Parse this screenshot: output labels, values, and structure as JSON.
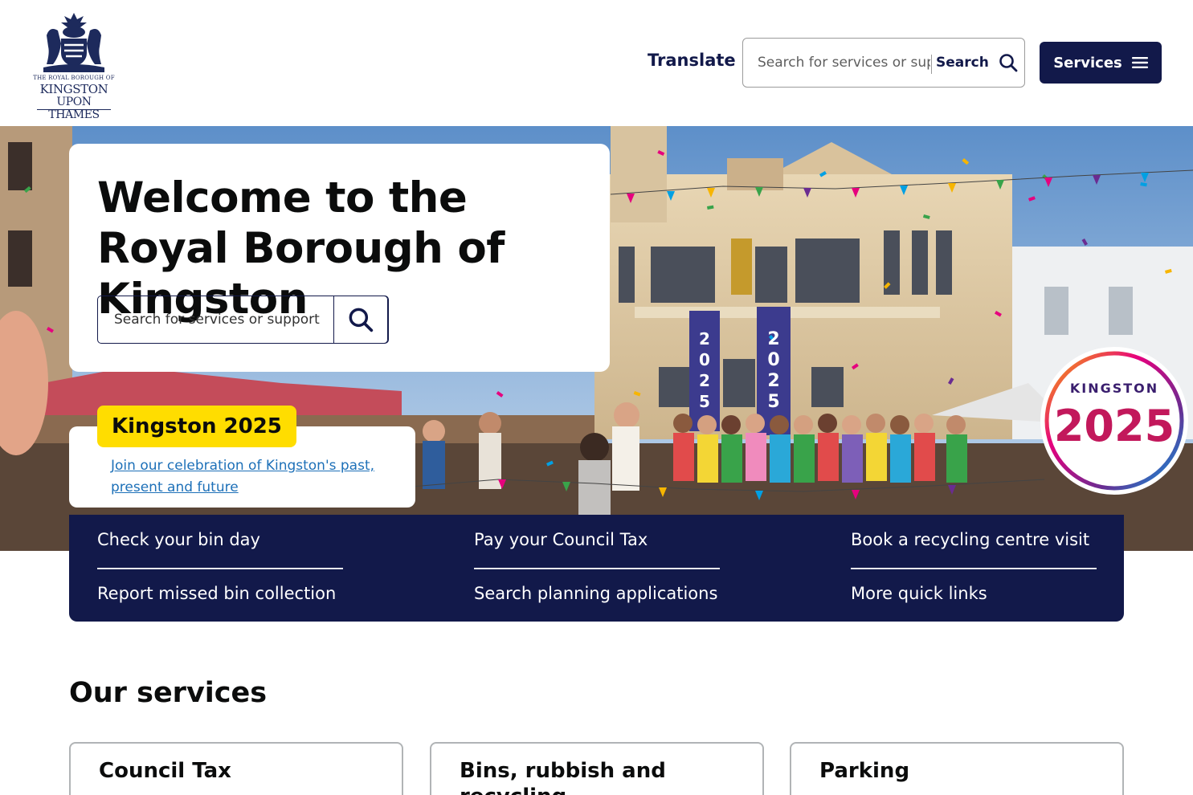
{
  "header": {
    "logo": {
      "small_text": "THE ROYAL BOROUGH OF",
      "line1": "KINGSTON",
      "line2": "UPON THAMES"
    },
    "translate_label": "Translate",
    "search": {
      "placeholder": "Search for services or support",
      "button_label": "Search",
      "icon": "search-icon"
    },
    "services_button": {
      "label": "Services",
      "icon": "menu-icon"
    }
  },
  "hero": {
    "title": "Welcome to the Royal Borough of Kingston",
    "search": {
      "placeholder": "Search for services or support",
      "icon": "search-icon"
    },
    "badge_logo": {
      "line1": "KINGSTON",
      "line2": "2025"
    },
    "banners": [
      "2025",
      "2025"
    ]
  },
  "promo": {
    "badge": "Kingston 2025",
    "link": "Join our celebration of Kingston's past, present and future"
  },
  "quick_links": [
    {
      "label": "Check your bin day"
    },
    {
      "label": "Pay your Council Tax"
    },
    {
      "label": "Book a recycling centre visit"
    },
    {
      "label": "Report missed bin collection"
    },
    {
      "label": "Search planning applications"
    },
    {
      "label": "More quick links"
    }
  ],
  "services": {
    "heading": "Our services",
    "cards": [
      {
        "title": "Council Tax"
      },
      {
        "title": "Bins, rubbish and recycling"
      },
      {
        "title": "Parking"
      }
    ]
  },
  "colors": {
    "navy": "#12194a",
    "yellow": "#ffdd00",
    "link": "#1d70b8"
  }
}
